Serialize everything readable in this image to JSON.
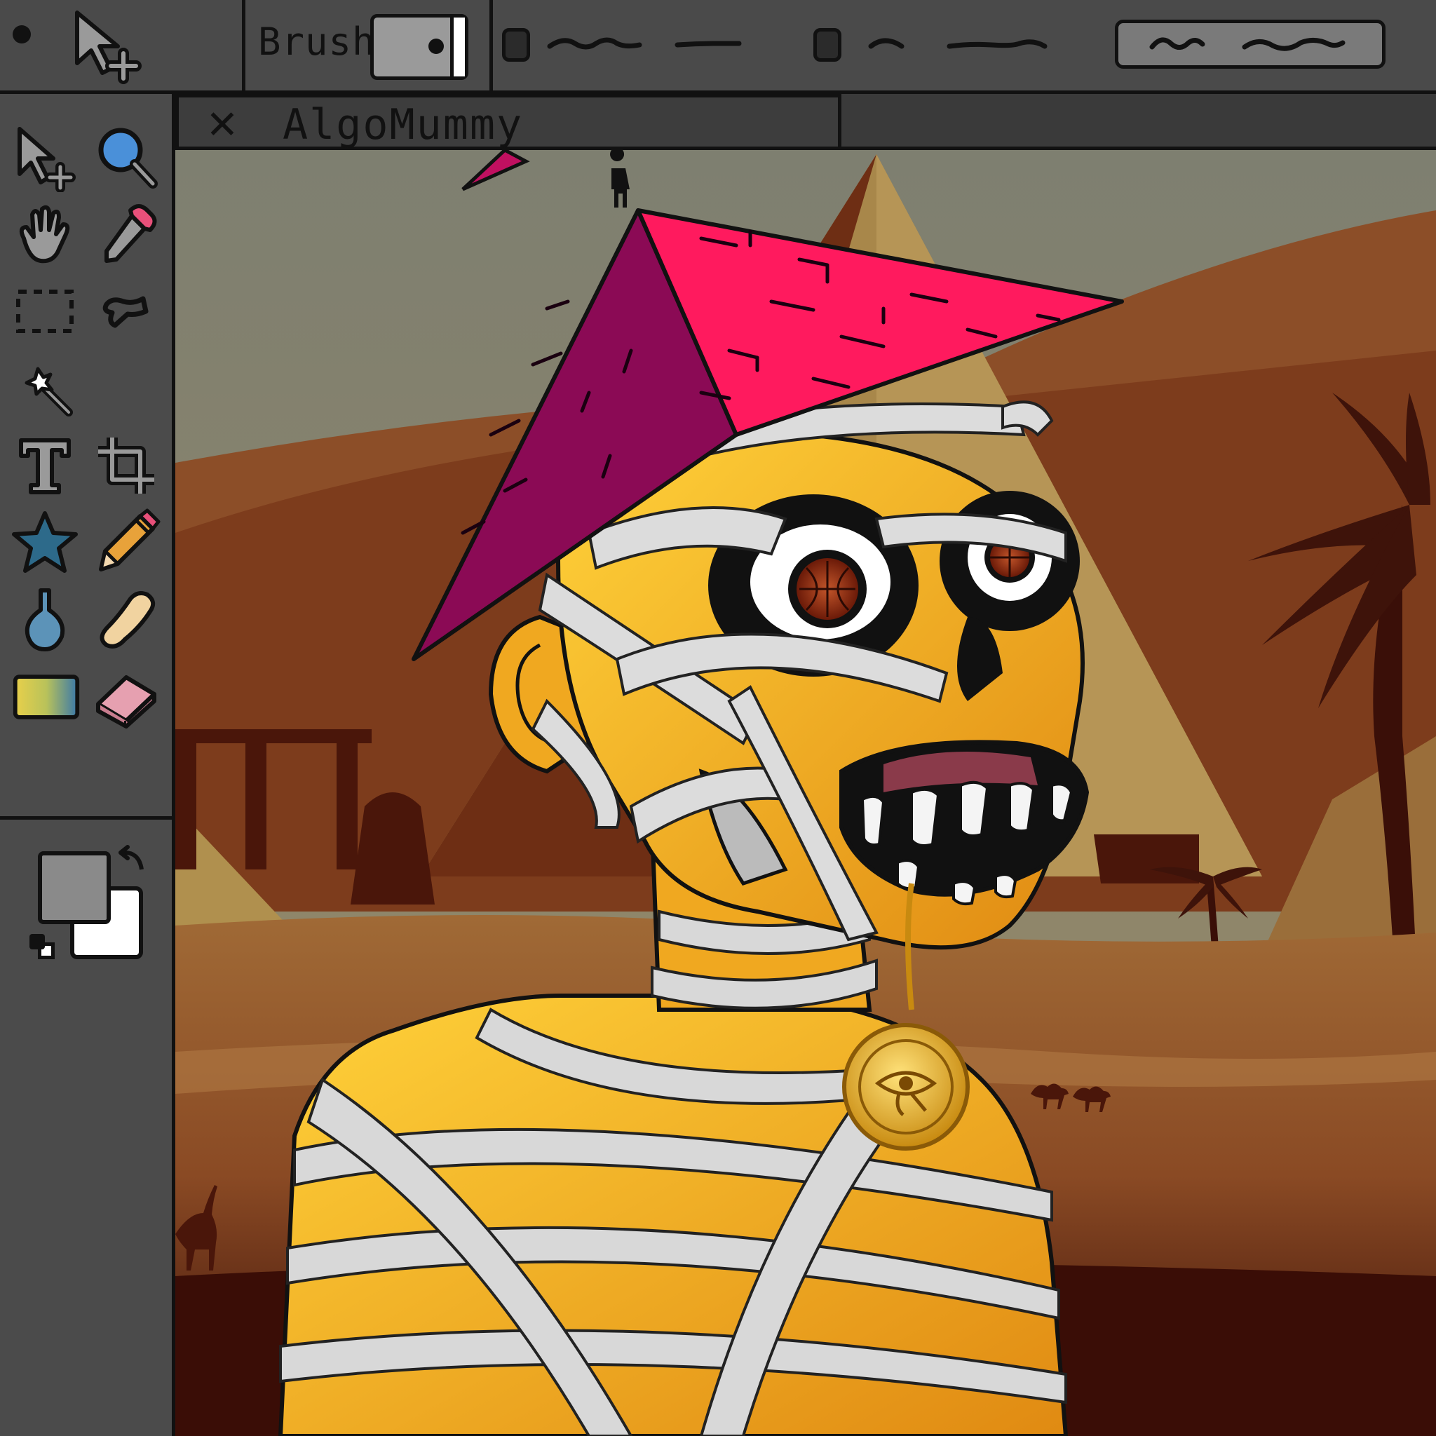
{
  "toolbar": {
    "brush_label": "Brush"
  },
  "document_tab": {
    "title": "AlgoMummy",
    "close_symbol": "✕"
  },
  "tools": [
    {
      "name": "move-selection-tool",
      "icon": "move-plus-icon"
    },
    {
      "name": "zoom-tool",
      "icon": "magnifier-icon"
    },
    {
      "name": "pan-tool",
      "icon": "hand-icon"
    },
    {
      "name": "color-picker-tool",
      "icon": "eyedropper-icon"
    },
    {
      "name": "rectangle-select-tool",
      "icon": "dashed-rect-icon"
    },
    {
      "name": "lasso-select-tool",
      "icon": "lasso-icon"
    },
    {
      "name": "magic-wand-tool",
      "icon": "magic-wand-icon"
    },
    {
      "name": "text-tool",
      "icon": "text-icon"
    },
    {
      "name": "crop-tool",
      "icon": "crop-icon"
    },
    {
      "name": "shapes-tool",
      "icon": "star-icon"
    },
    {
      "name": "pencil-tool",
      "icon": "pencil-icon"
    },
    {
      "name": "fill-tool",
      "icon": "drop-icon"
    },
    {
      "name": "smudge-tool",
      "icon": "smudge-icon"
    },
    {
      "name": "gradient-tool",
      "icon": "gradient-icon"
    },
    {
      "name": "eraser-tool",
      "icon": "eraser-icon"
    }
  ],
  "colors": {
    "primary": "#8a8a8a",
    "secondary": "#ffffff",
    "ui_panel": "#4b4b4b",
    "pyramid_hat_light": "#ff1a5e",
    "pyramid_hat_dark": "#8b0a55",
    "skin": "#f2b41e"
  }
}
